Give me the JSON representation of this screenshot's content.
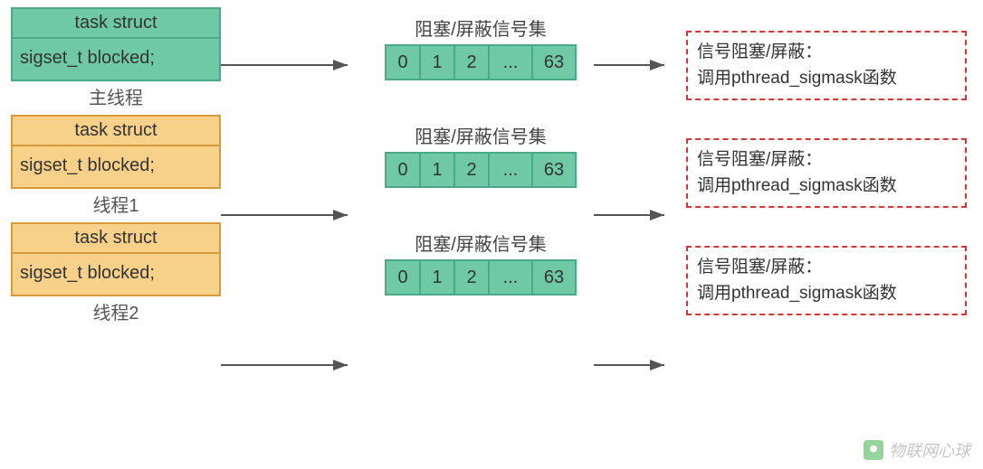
{
  "threads": [
    {
      "struct_header": "task struct",
      "struct_field": "sigset_t blocked;",
      "label": "主线程",
      "variant": "green",
      "sigset_label": "阻塞/屏蔽信号集",
      "bits": [
        "0",
        "1",
        "2",
        "...",
        "63"
      ],
      "note_line1": "信号阻塞/屏蔽：",
      "note_line2": "调用pthread_sigmask函数"
    },
    {
      "struct_header": "task struct",
      "struct_field": "sigset_t blocked;",
      "label": "线程1",
      "variant": "orange",
      "sigset_label": "阻塞/屏蔽信号集",
      "bits": [
        "0",
        "1",
        "2",
        "...",
        "63"
      ],
      "note_line1": "信号阻塞/屏蔽：",
      "note_line2": "调用pthread_sigmask函数"
    },
    {
      "struct_header": "task struct",
      "struct_field": "sigset_t blocked;",
      "label": "线程2",
      "variant": "orange",
      "sigset_label": "阻塞/屏蔽信号集",
      "bits": [
        "0",
        "1",
        "2",
        "...",
        "63"
      ],
      "note_line1": "信号阻塞/屏蔽：",
      "note_line2": "调用pthread_sigmask函数"
    }
  ],
  "watermark": "物联网心球"
}
